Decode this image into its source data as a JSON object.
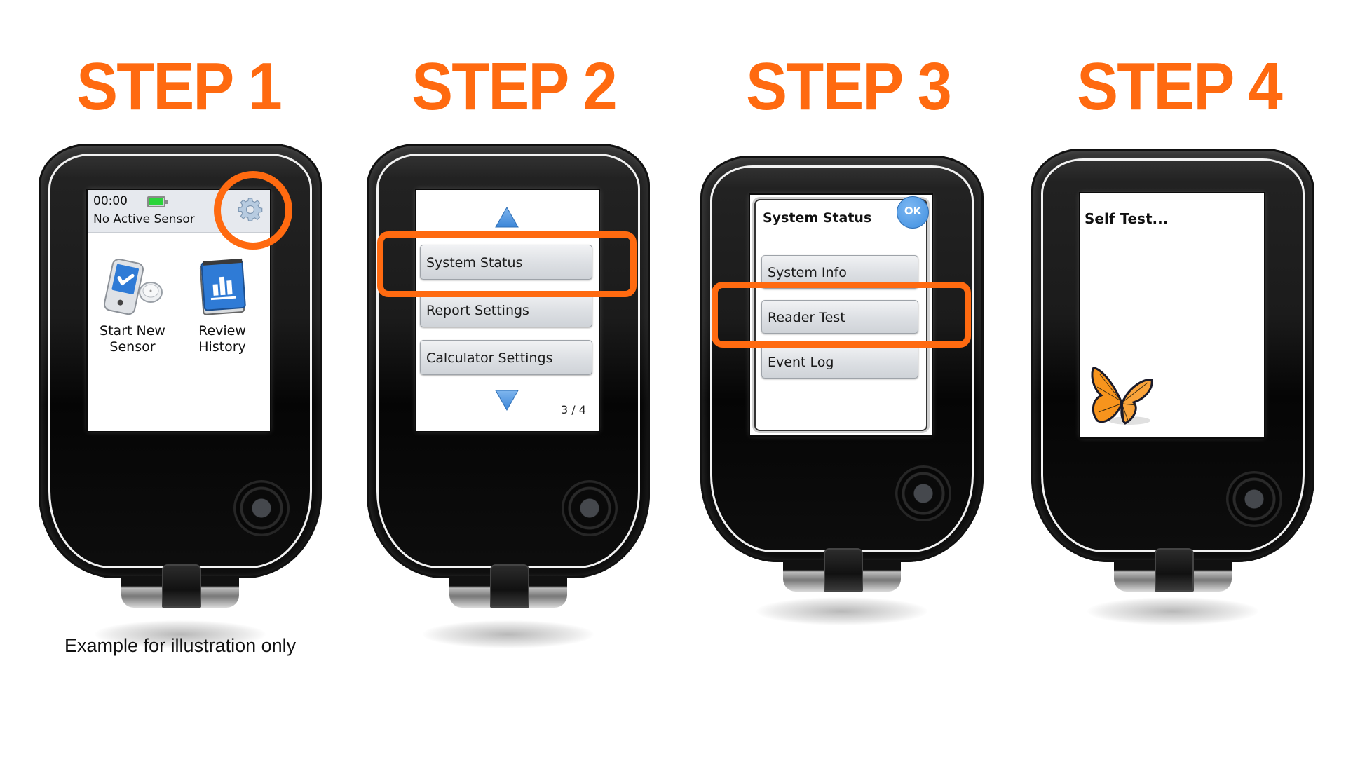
{
  "theme": {
    "accent": "#FF6A10",
    "screen_bg": "#FFFFFF",
    "device_color": "#111111",
    "blue_icon": "#2F7BD6"
  },
  "steps": [
    {
      "label": "STEP 1",
      "screen": {
        "time": "00:00",
        "status": "No Active Sensor",
        "battery_icon": "battery-charging-icon",
        "settings_icon": "gear-icon",
        "tiles": [
          {
            "label_line1": "Start New",
            "label_line2": "Sensor",
            "icon": "reader-sensor-icon"
          },
          {
            "label_line1": "Review",
            "label_line2": "History",
            "icon": "history-notebook-icon"
          }
        ],
        "highlight": "settings gear"
      }
    },
    {
      "label": "STEP 2",
      "screen": {
        "up_arrow": "up-arrow-icon",
        "menu": [
          "System Status",
          "Report Settings",
          "Calculator Settings"
        ],
        "down_arrow": "down-arrow-icon",
        "page_indicator": "3 / 4",
        "highlight": "System Status"
      }
    },
    {
      "label": "STEP 3",
      "screen": {
        "title": "System Status",
        "ok_label": "OK",
        "menu": [
          "System Info",
          "Reader Test",
          "Event Log"
        ],
        "highlight": "Reader Test"
      }
    },
    {
      "label": "STEP 4",
      "screen": {
        "message": "Self Test...",
        "image": "butterfly-icon"
      }
    }
  ],
  "footer": {
    "disclaimer": "Example for illustration only"
  }
}
